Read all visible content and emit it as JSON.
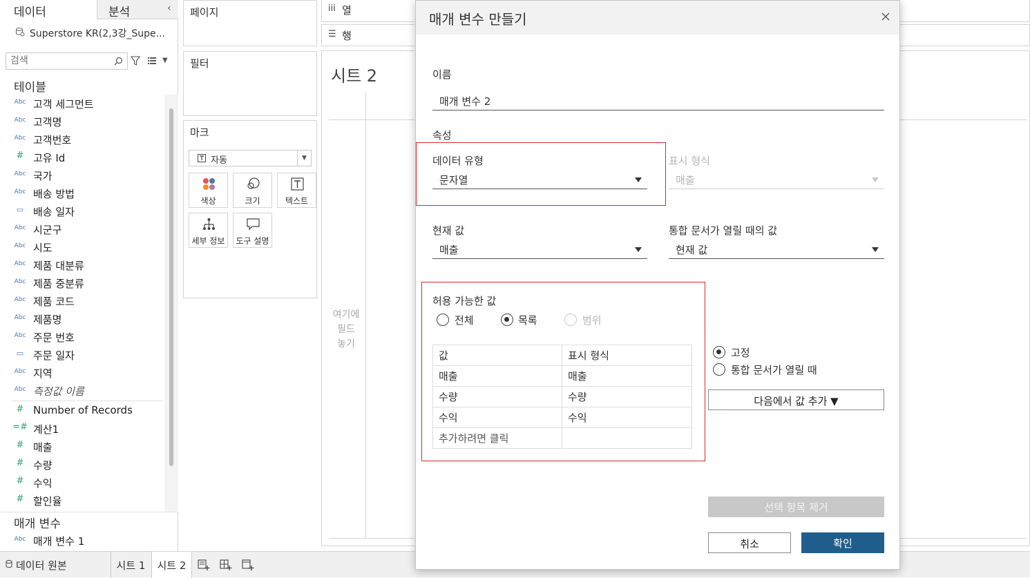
{
  "left_pane": {
    "tab_data": "데이터",
    "tab_analysis": "분석",
    "datasource": "Superstore KR(2,3강_Supe...",
    "search_placeholder": "검색",
    "tables_title": "테이블",
    "fields": [
      {
        "type": "Abc",
        "name": "고객 세그먼트"
      },
      {
        "type": "Abc",
        "name": "고객명"
      },
      {
        "type": "Abc",
        "name": "고객번호"
      },
      {
        "type": "#",
        "name": "고유 Id"
      },
      {
        "type": "Abc",
        "name": "국가"
      },
      {
        "type": "Abc",
        "name": "배송 방법"
      },
      {
        "type": "date",
        "name": "배송 일자"
      },
      {
        "type": "Abc",
        "name": "시군구"
      },
      {
        "type": "Abc",
        "name": "시도"
      },
      {
        "type": "Abc",
        "name": "제품 대분류"
      },
      {
        "type": "Abc",
        "name": "제품 중분류"
      },
      {
        "type": "Abc",
        "name": "제품 코드"
      },
      {
        "type": "Abc",
        "name": "제품명"
      },
      {
        "type": "Abc",
        "name": "주문 번호"
      },
      {
        "type": "date",
        "name": "주문 일자"
      },
      {
        "type": "Abc",
        "name": "지역"
      },
      {
        "type": "Abc",
        "name": "측정값 이름"
      }
    ],
    "measures": [
      {
        "type": "#",
        "name": "Number of Records"
      },
      {
        "type": "calc#",
        "name": "계산1"
      },
      {
        "type": "#",
        "name": "매출"
      },
      {
        "type": "#",
        "name": "수량"
      },
      {
        "type": "#",
        "name": "수익"
      },
      {
        "type": "#",
        "name": "할인율"
      }
    ],
    "params_title": "매개 변수",
    "params": [
      {
        "type": "Abc",
        "name": "매개 변수 1"
      }
    ]
  },
  "shelves": {
    "pages": "페이지",
    "filters": "필터",
    "marks": "마크",
    "marks_type": "자동",
    "mark_buttons": {
      "color": "색상",
      "size": "크기",
      "text": "텍스트",
      "detail": "세부 정보",
      "tooltip": "도구 설명"
    },
    "columns": "열",
    "rows": "행"
  },
  "sheet": {
    "title": "시트 2",
    "drop_hint_1": "여기에",
    "drop_hint_2": "필드",
    "drop_hint_3": "놓기"
  },
  "bottom_tabs": {
    "datasource": "데이터 원본",
    "sheet1": "시트 1",
    "sheet2": "시트 2"
  },
  "dialog": {
    "title": "매개 변수 만들기",
    "name_label": "이름",
    "name_value": "매개 변수 2",
    "properties_label": "속성",
    "data_type_label": "데이터 유형",
    "data_type_value": "문자열",
    "display_format_label": "표시 형식",
    "display_format_value": "매출",
    "current_value_label": "현재 값",
    "current_value_value": "매출",
    "workbook_open_label": "통합 문서가 열릴 때의 값",
    "workbook_open_value": "현재 값",
    "allowable_label": "허용 가능한 값",
    "radio_all": "전체",
    "radio_list": "목록",
    "radio_range": "범위",
    "table_headers": [
      "값",
      "표시 형식"
    ],
    "table_rows": [
      [
        "매출",
        "매출"
      ],
      [
        "수량",
        "수량"
      ],
      [
        "수익",
        "수익"
      ]
    ],
    "add_row_text": "추가하려면 클릭",
    "fixed_label": "고정",
    "when_open_label": "통합 문서가 열릴 때",
    "add_from_button": "다음에서 값 추가 ▼",
    "remove_button": "선택 항목 제거",
    "cancel_button": "취소",
    "ok_button": "확인"
  },
  "colors": {
    "accent": "#1f5e8c",
    "highlight_box": "#d9272b",
    "dimension_icon": "#4b7ab5",
    "measure_icon": "#3aa374"
  }
}
